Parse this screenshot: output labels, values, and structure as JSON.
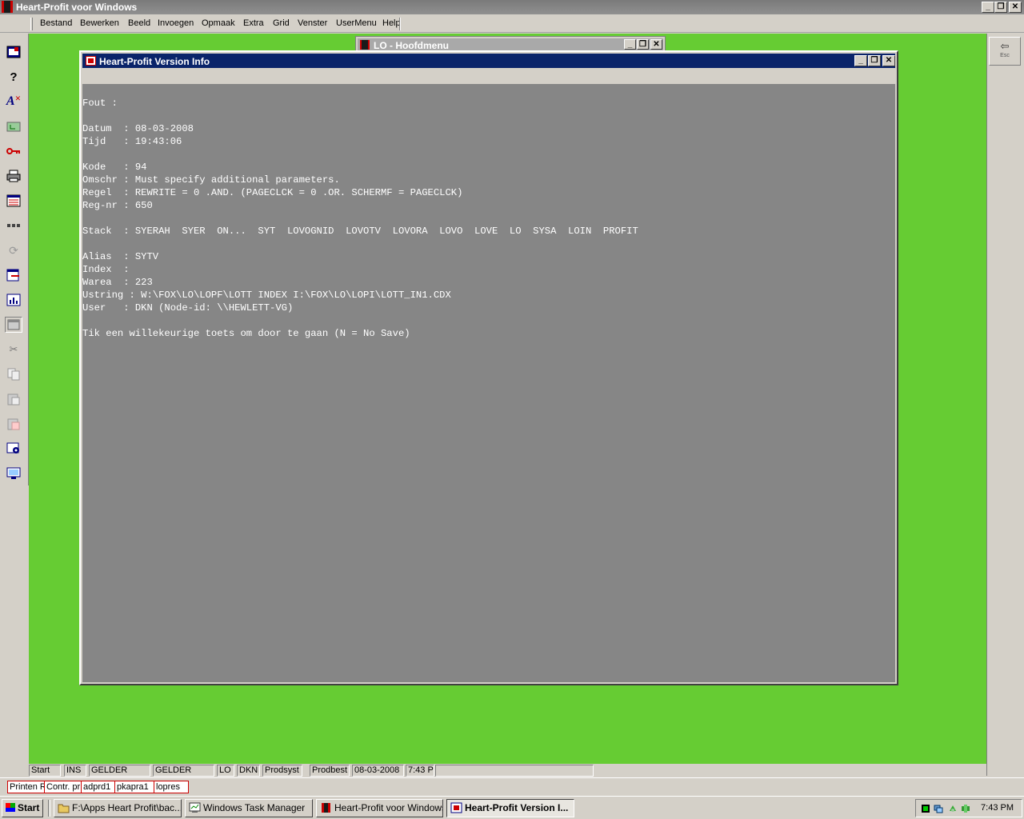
{
  "app": {
    "title": "Heart-Profit voor Windows",
    "caption_buttons": [
      "_",
      "❐",
      "✕"
    ]
  },
  "menu": [
    "Bestand",
    "Bewerken",
    "Beeld",
    "Invoegen",
    "Opmaak",
    "Extra",
    "Grid",
    "Venster",
    "UserMenu",
    "Help"
  ],
  "toolbar_icons": [
    "screen-icon",
    "help-icon",
    "spelling-icon",
    "folder-tree-icon",
    "key-icon",
    "printer-icon",
    "window-list-icon",
    "grid-dots-icon",
    "refresh-icon",
    "export-icon",
    "chart-icon",
    "window-icon",
    "cut-icon",
    "copy-icon",
    "paste-icon",
    "paste-special-icon",
    "settings-icon",
    "monitor-icon"
  ],
  "right_panel": {
    "esc_label": "Esc"
  },
  "background_window": {
    "title": "LO - Hoofdmenu"
  },
  "dialog": {
    "title": "Heart-Profit Version Info",
    "lines": [
      "",
      "Fout :",
      "",
      "Datum  : 08-03-2008",
      "Tijd   : 19:43:06",
      "",
      "Kode   : 94",
      "Omschr : Must specify additional parameters.",
      "Regel  : REWRITE = 0 .AND. (PAGECLCK = 0 .OR. SCHERMF = PAGECLCK)",
      "Reg-nr : 650",
      "",
      "Stack  : SYERAH  SYER  ON...  SYT  LOVOGNID  LOVOTV  LOVORA  LOVO  LOVE  LO  SYSA  LOIN  PROFIT",
      "",
      "Alias  : SYTV",
      "Index  :",
      "Warea  : 223",
      "Ustring : W:\\FOX\\LO\\LOPF\\LOTT INDEX I:\\FOX\\LO\\LOPI\\LOTT_IN1.CDX",
      "User   : DKN (Node-id: \\\\HEWLETT-VG)",
      "",
      "Tik een willekeurige toets om door te gaan (N = No Save)"
    ]
  },
  "statusbar": [
    "Start",
    "INS",
    "GELDER",
    "GELDER",
    "LO",
    "DKN",
    "Prodsyst",
    "Prodbest",
    "08-03-2008",
    "7:43 P",
    ""
  ],
  "window_tabs": [
    "Printen R",
    "Contr. pr",
    "adprd1",
    "pkapra1",
    "lopres"
  ],
  "taskbar": {
    "start_label": "Start",
    "tasks": [
      {
        "label": "F:\\Apps Heart Profit\\bac...",
        "icon": "folder-icon"
      },
      {
        "label": "Windows Task Manager",
        "icon": "task-manager-icon"
      },
      {
        "label": "Heart-Profit voor Windows",
        "icon": "heart-profit-icon"
      },
      {
        "label": "Heart-Profit Version I...",
        "icon": "heart-profit-info-icon",
        "active": true
      }
    ],
    "clock": "7:43 PM"
  },
  "colors": {
    "workspace": "#66cc33",
    "console_bg": "#868686",
    "active_caption": "#0a246a",
    "inactive_caption": "#a9a9a9"
  }
}
